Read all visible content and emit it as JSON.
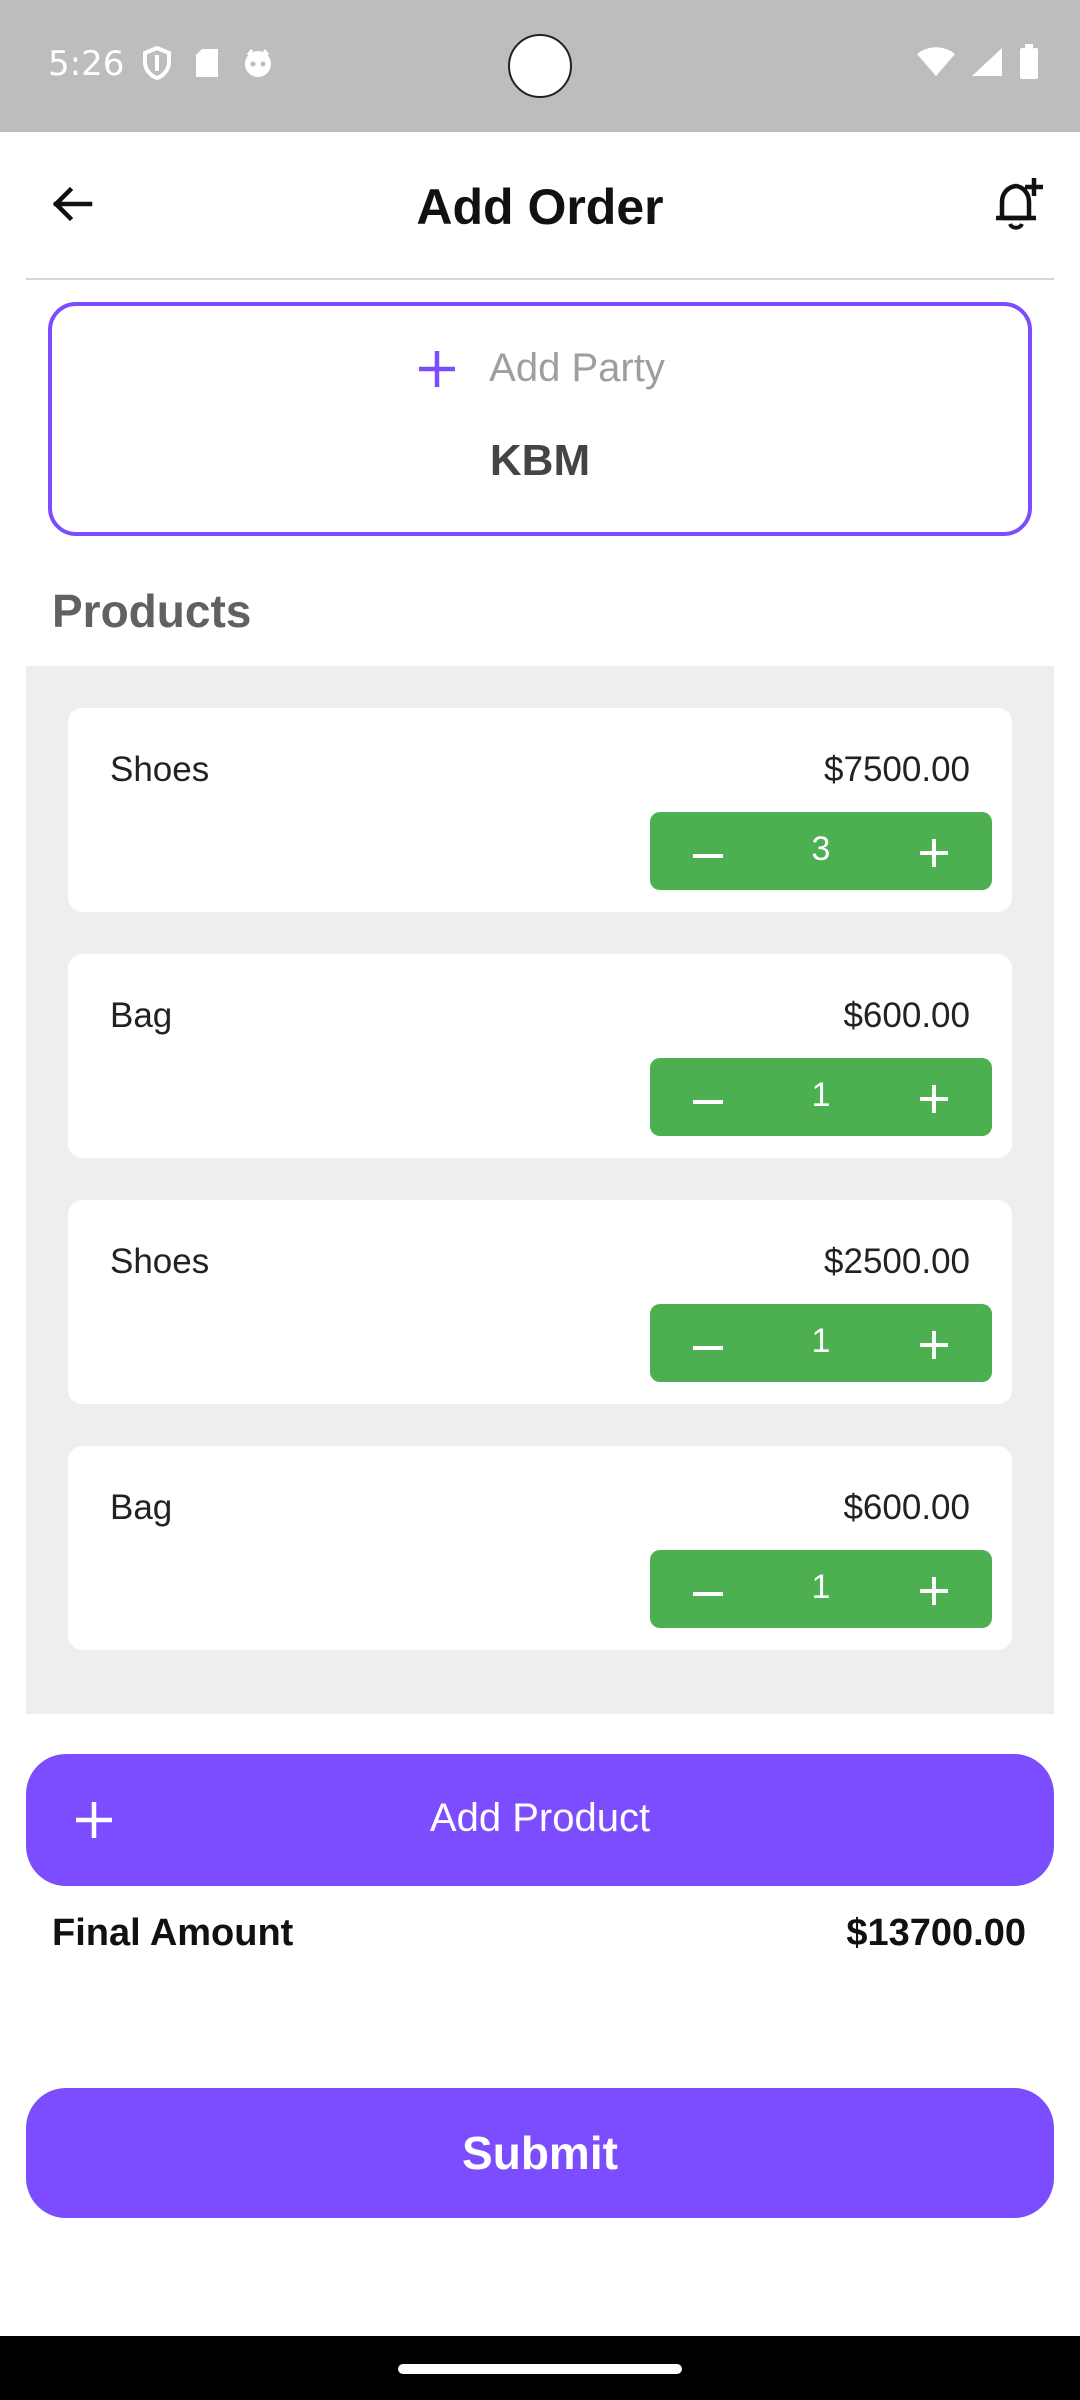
{
  "status_bar": {
    "time": "5:26",
    "icons_left": [
      "shield-icon",
      "sd-card-icon",
      "notification-face-icon"
    ],
    "icons_right": [
      "wifi-icon",
      "cell-signal-icon",
      "battery-icon"
    ],
    "background_color": "#bdbdbd"
  },
  "app_bar": {
    "title": "Add Order",
    "back_icon": "arrow-left-icon",
    "action_icon": "bell-plus-icon"
  },
  "party": {
    "add_label": "Add Party",
    "selected_name": "KBM",
    "accent_color": "#7c4dff"
  },
  "products": {
    "heading": "Products",
    "items": [
      {
        "name": "Shoes",
        "price": "$7500.00",
        "quantity": "3"
      },
      {
        "name": "Bag",
        "price": "$600.00",
        "quantity": "1"
      },
      {
        "name": "Shoes",
        "price": "$2500.00",
        "quantity": "1"
      },
      {
        "name": "Bag",
        "price": "$600.00",
        "quantity": "1"
      }
    ],
    "stepper_color": "#4caf50"
  },
  "add_product": {
    "label": "Add Product"
  },
  "summary": {
    "final_label": "Final Amount",
    "final_value": "$13700.00"
  },
  "submit": {
    "label": "Submit"
  }
}
